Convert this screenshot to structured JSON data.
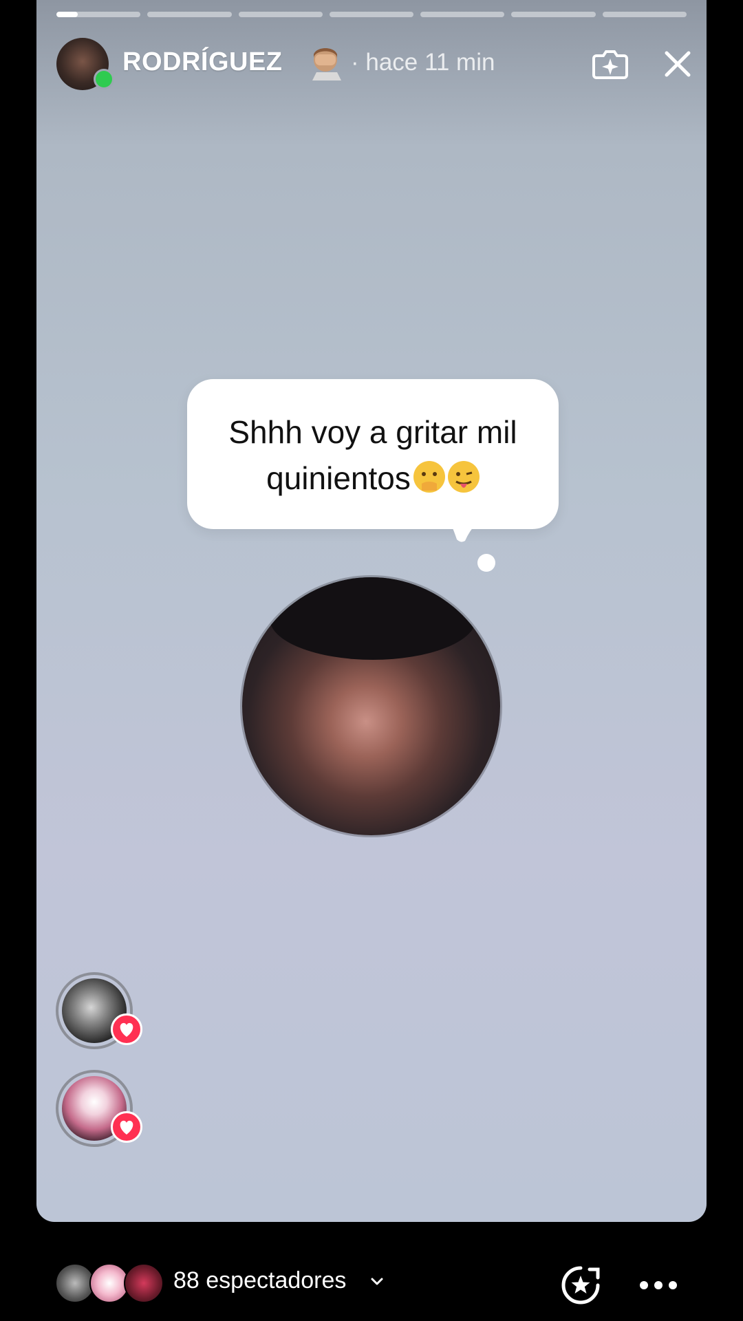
{
  "story": {
    "progress": {
      "segments": 7,
      "current_index": 0,
      "current_fill": 0.25
    },
    "user": {
      "username": "RODRÍGUEZ",
      "username_emoji": "facepalm-emoji",
      "time": "· hace 11 min",
      "online": true
    },
    "buttons": {
      "effects": "sparkle-camera-icon",
      "close": "close-icon"
    },
    "note": {
      "line1": "Shhh voy a gritar mil",
      "line2": "quinientos",
      "emojis": [
        "hand-over-mouth-emoji",
        "tongue-out-emoji"
      ]
    },
    "likers": [
      {
        "badge": "heart-icon"
      },
      {
        "badge": "heart-icon"
      }
    ]
  },
  "footer": {
    "viewer_count_label": "88 espectadores",
    "actions": [
      "highlight-star-icon",
      "more-icon"
    ]
  },
  "colors": {
    "like_red": "#ff3052",
    "online_green": "#2ecb4f"
  }
}
